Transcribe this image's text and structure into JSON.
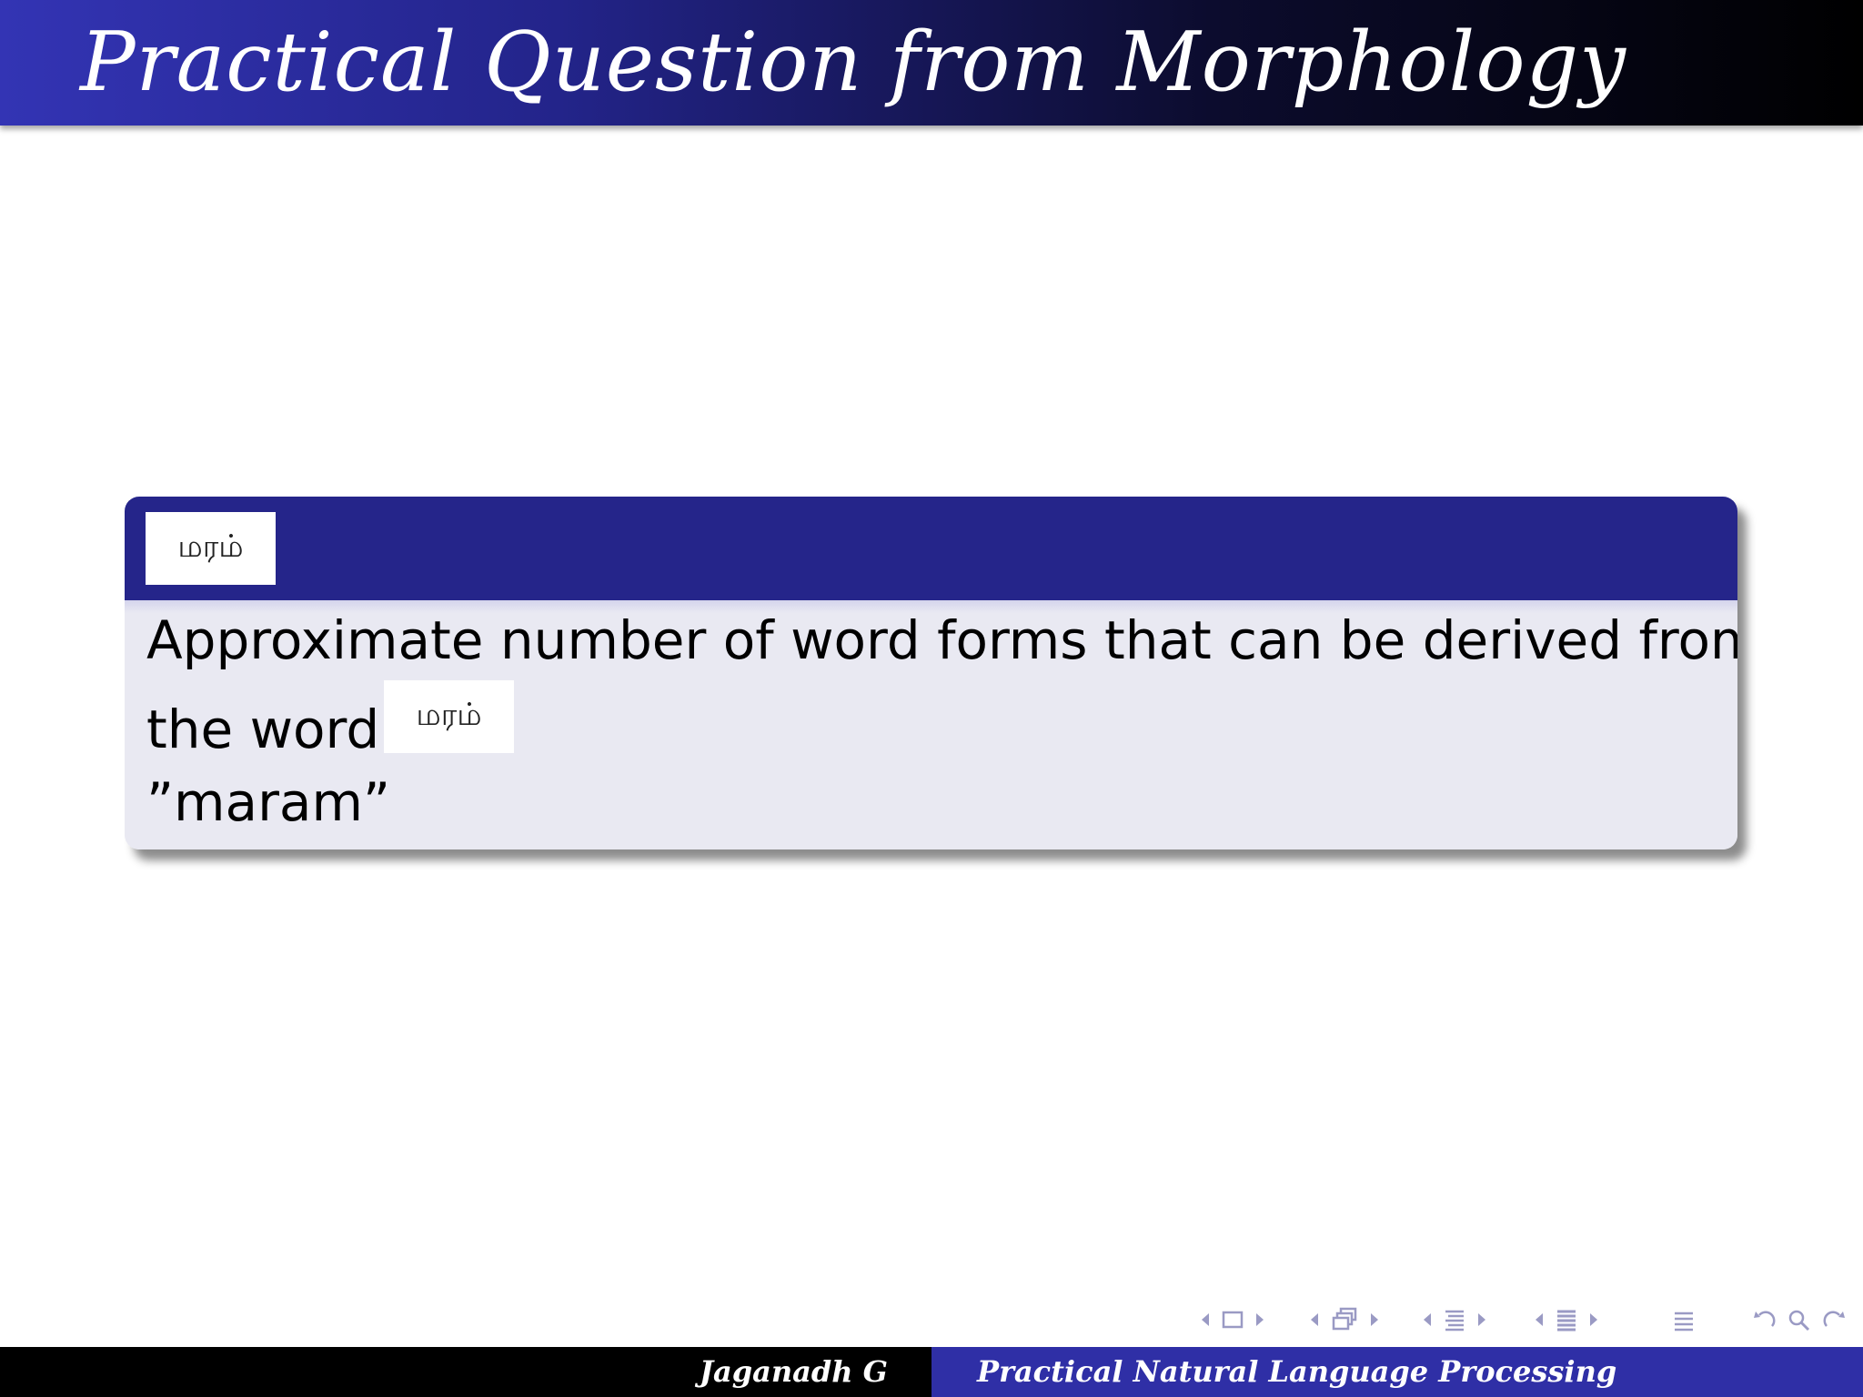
{
  "slide": {
    "title": "Practical Question from Morphology"
  },
  "block": {
    "header_word": "மரம்",
    "body_line1": "Approximate number of word forms that can be derived from",
    "body_line2": "the word",
    "body_word": "மரம்",
    "body_line3": "”maram”"
  },
  "nav": {
    "icons": [
      "nav-prev-icon",
      "frame-icon",
      "nav-next-icon",
      "nav-prev-icon",
      "subsection-icon",
      "nav-next-icon",
      "nav-prev-icon",
      "section-icon",
      "nav-next-icon",
      "nav-prev-icon",
      "slide-list-icon",
      "nav-next-icon",
      "toc-icon",
      "back-icon",
      "search-icon",
      "forward-icon"
    ]
  },
  "footer": {
    "author": "Jaganadh G",
    "title": "Practical Natural Language Processing"
  }
}
